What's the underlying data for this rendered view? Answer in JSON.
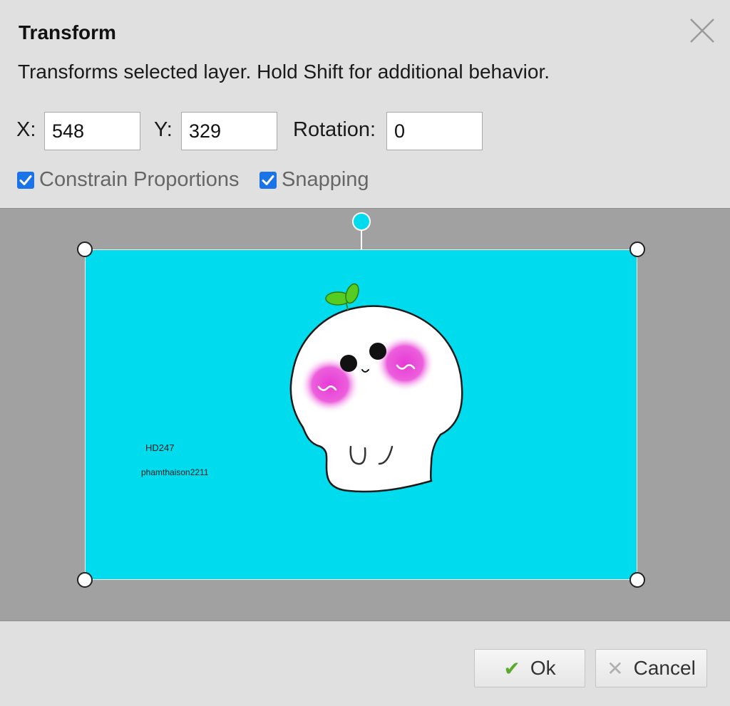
{
  "dialog": {
    "title": "Transform",
    "description": "Transforms selected layer. Hold Shift for additional behavior.",
    "close_icon": "close-icon"
  },
  "fields": {
    "x_label": "X:",
    "x_value": "548",
    "y_label": "Y:",
    "y_value": "329",
    "rotation_label": "Rotation:",
    "rotation_value": "0"
  },
  "options": {
    "constrain_label": "Constrain Proportions",
    "constrain_checked": true,
    "snapping_label": "Snapping",
    "snapping_checked": true
  },
  "layer": {
    "background_color": "#00dcee",
    "text_1": "HD247",
    "text_2": "phamthaison2211"
  },
  "buttons": {
    "ok_label": "Ok",
    "ok_icon": "checkmark-icon",
    "cancel_label": "Cancel",
    "cancel_icon": "x-icon"
  },
  "colors": {
    "dialog_bg": "#e0e0e0",
    "canvas_bg": "#a1a1a1",
    "checkbox": "#1a73e8",
    "ok_check": "#5aaa2c"
  }
}
